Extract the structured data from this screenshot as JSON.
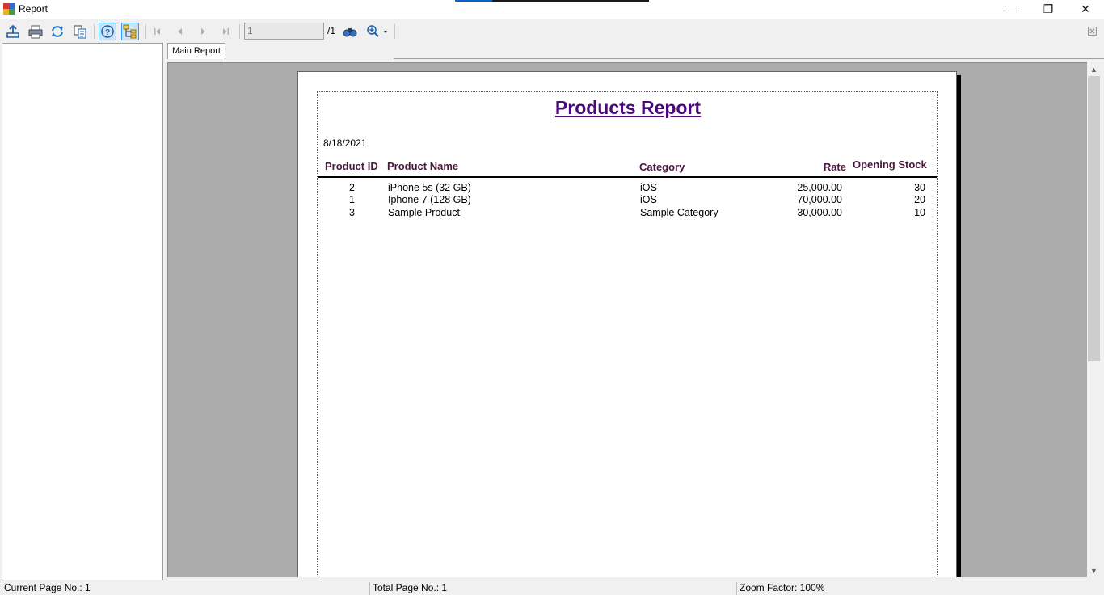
{
  "window": {
    "title": "Report",
    "minimize_glyph": "—",
    "restore_glyph": "❐",
    "close_glyph": "✕"
  },
  "toolbar": {
    "icons": [
      "export-icon",
      "print-icon",
      "refresh-icon",
      "copy-icon",
      "help-icon",
      "group-tree-icon",
      "first-page-icon",
      "previous-page-icon",
      "next-page-icon",
      "last-page-icon",
      "find-icon",
      "zoom-icon",
      "close-view-icon"
    ],
    "current_page": "1",
    "total_pages": "/1"
  },
  "tabs": [
    {
      "label": "Main Report"
    }
  ],
  "report": {
    "title": "Products Report",
    "date": "8/18/2021",
    "columns": [
      "Product ID",
      "Product Name",
      "Category",
      "Rate",
      "Opening Stock"
    ],
    "rows": [
      {
        "id": "2",
        "name": "iPhone 5s (32 GB)",
        "category": "iOS",
        "rate": "25,000.00",
        "stock": "30"
      },
      {
        "id": "1",
        "name": "Iphone 7 (128 GB)",
        "category": "iOS",
        "rate": "70,000.00",
        "stock": "20"
      },
      {
        "id": "3",
        "name": "Sample Product",
        "category": "Sample Category",
        "rate": "30,000.00",
        "stock": "10"
      }
    ]
  },
  "statusbar": {
    "current_page": "Current Page No.: 1",
    "total_pages": "Total Page No.: 1",
    "zoom": "Zoom Factor: 100%"
  },
  "colors": {
    "title_color": "#4b0a7a",
    "header_color": "#4b1740",
    "viewer_bg": "#ababab",
    "accent": "#3399ff"
  }
}
